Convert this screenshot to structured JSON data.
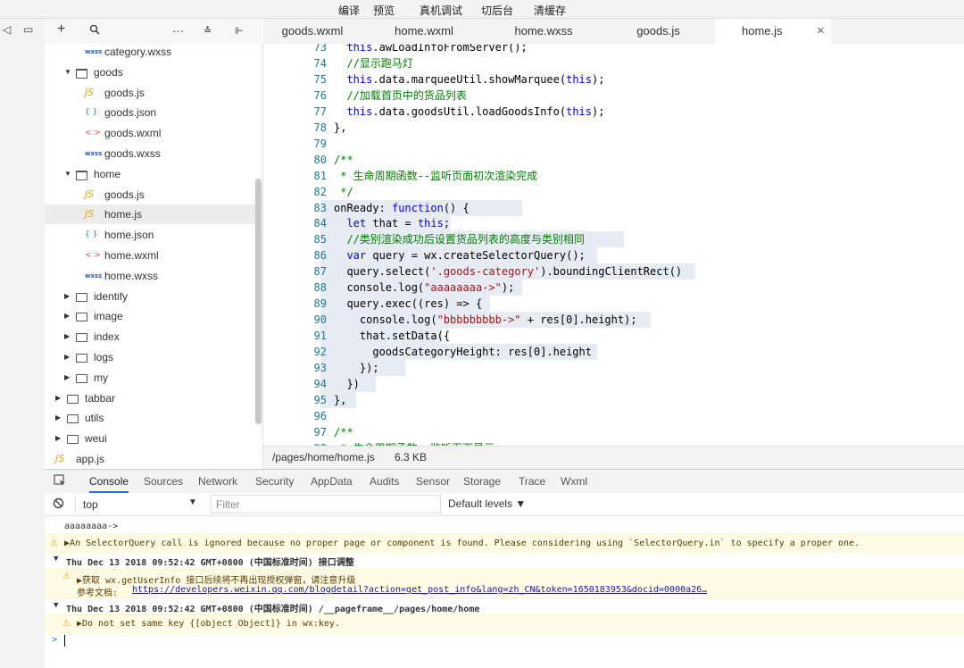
{
  "toolbar": {
    "compile": "编译",
    "preview": "预览",
    "remote_debug": "真机调试",
    "background": "切后台",
    "clear_cache": "清缓存"
  },
  "left_strip": {
    "icons": [
      "panel-left-icon",
      "window-icon"
    ]
  },
  "tree_header": {
    "icons": [
      "add-icon",
      "search-icon",
      "more-icon",
      "collapse-all-icon",
      "split-icon"
    ],
    "more_label": "···"
  },
  "file_tree": [
    {
      "name": "category.wxss",
      "type": "wxss",
      "depth": 2
    },
    {
      "name": "goods",
      "type": "folder-open",
      "depth": 1
    },
    {
      "name": "goods.js",
      "type": "js",
      "depth": 2
    },
    {
      "name": "goods.json",
      "type": "json",
      "depth": 2
    },
    {
      "name": "goods.wxml",
      "type": "wxml",
      "depth": 2
    },
    {
      "name": "goods.wxss",
      "type": "wxss",
      "depth": 2
    },
    {
      "name": "home",
      "type": "folder-open",
      "depth": 1
    },
    {
      "name": "goods.js",
      "type": "js",
      "depth": 2
    },
    {
      "name": "home.js",
      "type": "js",
      "depth": 2,
      "selected": true
    },
    {
      "name": "home.json",
      "type": "json",
      "depth": 2
    },
    {
      "name": "home.wxml",
      "type": "wxml",
      "depth": 2
    },
    {
      "name": "home.wxss",
      "type": "wxss",
      "depth": 2
    },
    {
      "name": "identify",
      "type": "folder",
      "depth": 1
    },
    {
      "name": "image",
      "type": "folder",
      "depth": 1
    },
    {
      "name": "index",
      "type": "folder",
      "depth": 1
    },
    {
      "name": "logs",
      "type": "folder",
      "depth": 1
    },
    {
      "name": "my",
      "type": "folder",
      "depth": 1
    },
    {
      "name": "tabbar",
      "type": "folder",
      "depth": 0
    },
    {
      "name": "utils",
      "type": "folder",
      "depth": 0
    },
    {
      "name": "weui",
      "type": "folder",
      "depth": 0
    },
    {
      "name": "app.js",
      "type": "js",
      "depth": 0
    }
  ],
  "file_icons": {
    "js": "JS",
    "json": "{ }",
    "wxml": "< >",
    "wxss": "wxss"
  },
  "editor_tabs": [
    {
      "label": "goods.wxml"
    },
    {
      "label": "home.wxml"
    },
    {
      "label": "home.wxss"
    },
    {
      "label": "goods.js"
    },
    {
      "label": "home.js",
      "active": true
    }
  ],
  "tab_close": "×",
  "code_lines": [
    {
      "n": "73",
      "text": "  this.awLoadInfoFromServer();"
    },
    {
      "n": "74",
      "text": "  //显示跑马灯"
    },
    {
      "n": "75",
      "text": "  this.data.marqueeUtil.showMarquee(this);"
    },
    {
      "n": "76",
      "text": "  //加载首页中的货品列表"
    },
    {
      "n": "77",
      "text": "  this.data.goodsUtil.loadGoodsInfo(this);"
    },
    {
      "n": "78",
      "text": "},"
    },
    {
      "n": "79",
      "text": ""
    },
    {
      "n": "80",
      "text": "/**"
    },
    {
      "n": "81",
      "text": " * 生命周期函数--监听页面初次渲染完成"
    },
    {
      "n": "82",
      "text": " */"
    },
    {
      "n": "83",
      "text": "onReady: function() {"
    },
    {
      "n": "84",
      "text": "  let that = this;"
    },
    {
      "n": "85",
      "text": "  //类别渲染成功后设置货品列表的高度与类别相同"
    },
    {
      "n": "86",
      "text": "  var query = wx.createSelectorQuery();"
    },
    {
      "n": "87",
      "text": "  query.select('.goods-category').boundingClientRect()"
    },
    {
      "n": "88",
      "text": "  console.log(\"aaaaaaaa->\");"
    },
    {
      "n": "89",
      "text": "  query.exec((res) => {"
    },
    {
      "n": "90",
      "text": "    console.log(\"bbbbbbbbb->\" + res[0].height);"
    },
    {
      "n": "91",
      "text": "    that.setData({"
    },
    {
      "n": "92",
      "text": "      goodsCategoryHeight: res[0].height"
    },
    {
      "n": "93",
      "text": "    });"
    },
    {
      "n": "94",
      "text": "  })"
    },
    {
      "n": "95",
      "text": "},"
    },
    {
      "n": "96",
      "text": ""
    },
    {
      "n": "97",
      "text": "/**"
    },
    {
      "n": "98",
      "text": " * 生命周期函数--监听页面显示"
    }
  ],
  "status": {
    "path": "/pages/home/home.js",
    "size": "6.3 KB"
  },
  "devtools_tabs": [
    {
      "label": "Console",
      "active": true
    },
    {
      "label": "Sources"
    },
    {
      "label": "Network"
    },
    {
      "label": "Security"
    },
    {
      "label": "AppData"
    },
    {
      "label": "Audits"
    },
    {
      "label": "Sensor"
    },
    {
      "label": "Storage"
    },
    {
      "label": "Trace"
    },
    {
      "label": "Wxml"
    }
  ],
  "filter_bar": {
    "context": "top",
    "filter_placeholder": "Filter",
    "levels": "Default levels ▼"
  },
  "console": {
    "line1": "aaaaaaaa->",
    "warn1": "▶An SelectorQuery call is ignored because no proper page or component is found. Please considering using `SelectorQuery.in` to specify a proper one.",
    "group1": "Thu Dec 13 2018 09:52:42 GMT+0800 (中国标准时间) 接口调整",
    "warn2a": "▶获取 wx.getUserInfo 接口后续将不再出现授权弹窗，请注意升级",
    "warn2b_prefix": "参考文档: ",
    "warn2b_link": "https://developers.weixin.qq.com/blogdetail?action=get_post_info&lang=zh_CN&token=1650183953&docid=0000a26…",
    "group2": "Thu Dec 13 2018 09:52:42 GMT+0800 (中国标准时间) /__pageframe__/pages/home/home",
    "warn3": "▶Do not set same key {[object Object]} in wx:key.",
    "prompt": ">"
  }
}
